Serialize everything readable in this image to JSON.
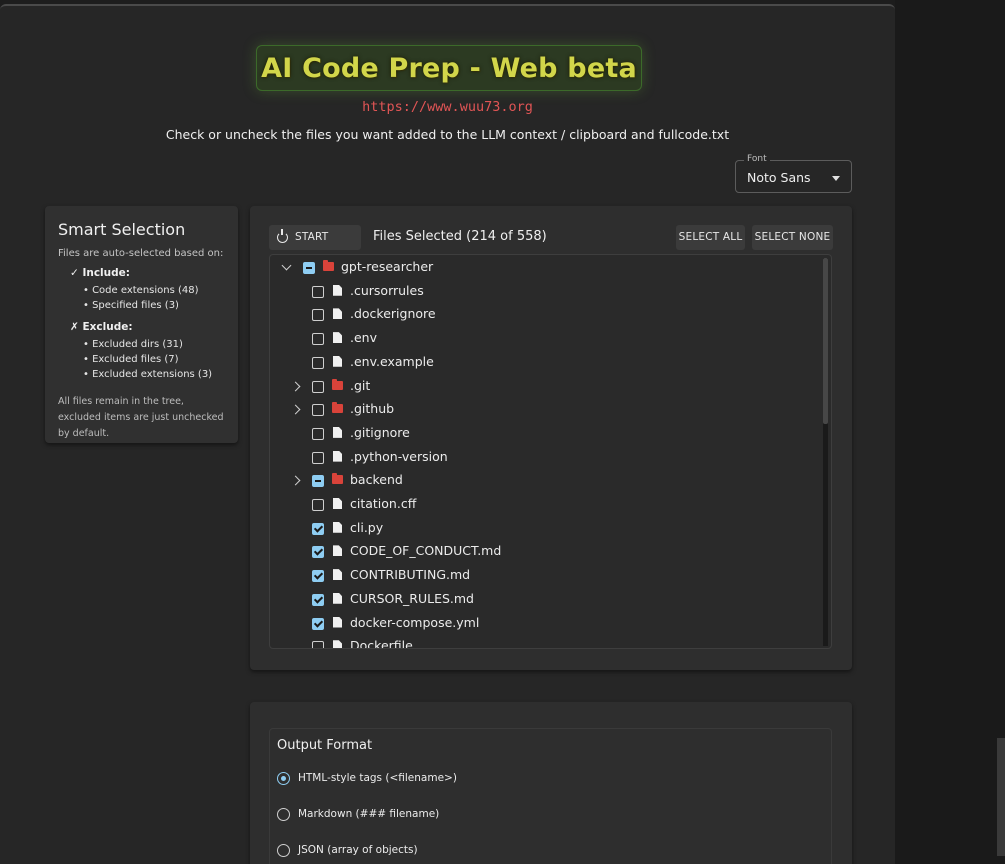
{
  "header": {
    "title": "AI Code Prep - Web beta",
    "url": "https://www.wuu73.org",
    "instructions": "Check or uncheck the files you want added to the LLM context / clipboard and fullcode.txt"
  },
  "font_selector": {
    "label": "Font",
    "value": "Noto Sans"
  },
  "smart_selection": {
    "title": "Smart Selection",
    "intro": "Files are auto-selected based on:",
    "include_label": "✓ Include:",
    "include_items": [
      "• Code extensions (48)",
      "• Specified files (3)"
    ],
    "exclude_label": "✗ Exclude:",
    "exclude_items": [
      "• Excluded dirs (31)",
      "• Excluded files (7)",
      "• Excluded extensions (3)"
    ],
    "note": "All files remain in the tree, excluded items are just unchecked by default."
  },
  "files": {
    "start_over_label": "START OVER",
    "count_label": "Files Selected (214 of 558)",
    "select_all_label": "SELECT ALL",
    "select_none_label": "SELECT NONE",
    "tree": [
      {
        "name": "gpt-researcher",
        "type": "dir",
        "state": "indeterminate",
        "expanded": true,
        "depth": 0
      },
      {
        "name": ".cursorrules",
        "type": "file",
        "state": "unchecked",
        "depth": 1
      },
      {
        "name": ".dockerignore",
        "type": "file",
        "state": "unchecked",
        "depth": 1
      },
      {
        "name": ".env",
        "type": "file",
        "state": "unchecked",
        "depth": 1
      },
      {
        "name": ".env.example",
        "type": "file",
        "state": "unchecked",
        "depth": 1
      },
      {
        "name": ".git",
        "type": "dir",
        "state": "unchecked",
        "expanded": false,
        "depth": 1
      },
      {
        "name": ".github",
        "type": "dir",
        "state": "unchecked",
        "expanded": false,
        "depth": 1
      },
      {
        "name": ".gitignore",
        "type": "file",
        "state": "unchecked",
        "depth": 1
      },
      {
        "name": ".python-version",
        "type": "file",
        "state": "unchecked",
        "depth": 1
      },
      {
        "name": "backend",
        "type": "dir",
        "state": "indeterminate",
        "expanded": false,
        "depth": 1
      },
      {
        "name": "citation.cff",
        "type": "file",
        "state": "unchecked",
        "depth": 1
      },
      {
        "name": "cli.py",
        "type": "file",
        "state": "checked",
        "depth": 1
      },
      {
        "name": "CODE_OF_CONDUCT.md",
        "type": "file",
        "state": "checked",
        "depth": 1
      },
      {
        "name": "CONTRIBUTING.md",
        "type": "file",
        "state": "checked",
        "depth": 1
      },
      {
        "name": "CURSOR_RULES.md",
        "type": "file",
        "state": "checked",
        "depth": 1
      },
      {
        "name": "docker-compose.yml",
        "type": "file",
        "state": "checked",
        "depth": 1
      },
      {
        "name": "Dockerfile",
        "type": "file",
        "state": "unchecked",
        "depth": 1
      }
    ]
  },
  "output": {
    "title": "Output Format",
    "options": [
      {
        "label": "HTML-style tags (<filename>)",
        "selected": true
      },
      {
        "label": "Markdown (### filename)",
        "selected": false
      },
      {
        "label": "JSON (array of objects)",
        "selected": false
      }
    ]
  }
}
